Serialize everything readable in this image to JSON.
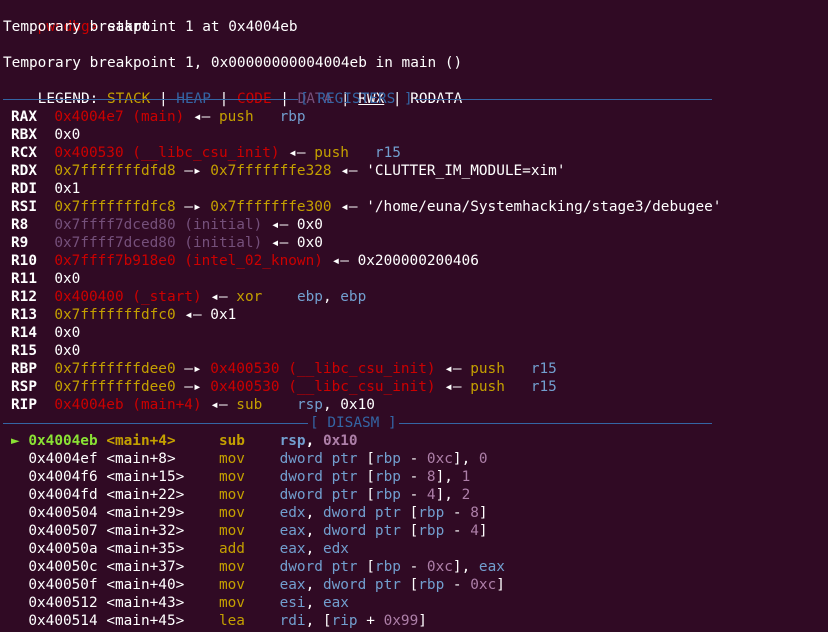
{
  "prompt": "pwndbg>",
  "command": " start",
  "info1": "Temporary breakpoint 1 at 0x4004eb",
  "info2": "Temporary breakpoint 1, 0x00000000004004eb in main ()",
  "legend": {
    "label": "LEGEND: ",
    "stack": "STACK",
    "heap": "HEAP",
    "code": "CODE",
    "data": "DATA",
    "rwx": "RWX",
    "rodata": "RODATA",
    "sep": " | "
  },
  "sections": {
    "registers": "[ REGISTERS ]",
    "disasm": "[ DISASM ]"
  },
  "colors": {
    "background": "#300a24",
    "stack": "#c4a000",
    "heap": "#3465a4",
    "code": "#cc0000",
    "data": "#75507b",
    "separator": "#3465a4",
    "current": "#8ae234"
  },
  "registers": [
    {
      "name": "RAX",
      "parts": [
        [
          "red",
          "0x4004e7 (main)"
        ],
        [
          "wht",
          " ◂— "
        ],
        [
          "yel",
          "push"
        ],
        [
          "wht",
          "   "
        ],
        [
          "ltblu",
          "rbp"
        ]
      ]
    },
    {
      "name": "RBX",
      "parts": [
        [
          "wht",
          "0x0"
        ]
      ]
    },
    {
      "name": "RCX",
      "parts": [
        [
          "red",
          "0x400530 (__libc_csu_init)"
        ],
        [
          "wht",
          " ◂— "
        ],
        [
          "yel",
          "push"
        ],
        [
          "wht",
          "   "
        ],
        [
          "ltblu",
          "r15"
        ]
      ]
    },
    {
      "name": "RDX",
      "parts": [
        [
          "yel",
          "0x7fffffffdfd8"
        ],
        [
          "wht",
          " —▸ "
        ],
        [
          "yel",
          "0x7fffffffe328"
        ],
        [
          "wht",
          " ◂— 'CLUTTER_IM_MODULE=xim'"
        ]
      ]
    },
    {
      "name": "RDI",
      "parts": [
        [
          "wht",
          "0x1"
        ]
      ]
    },
    {
      "name": "RSI",
      "parts": [
        [
          "yel",
          "0x7fffffffdfc8"
        ],
        [
          "wht",
          " —▸ "
        ],
        [
          "yel",
          "0x7fffffffe300"
        ],
        [
          "wht",
          " ◂— '/home/euna/Systemhacking/stage3/debugee'"
        ]
      ]
    },
    {
      "name": "R8",
      "parts": [
        [
          "dim",
          "0x7ffff7dced80 (initial)"
        ],
        [
          "wht",
          " ◂— 0x0"
        ]
      ]
    },
    {
      "name": "R9",
      "parts": [
        [
          "dim",
          "0x7ffff7dced80 (initial)"
        ],
        [
          "wht",
          " ◂— 0x0"
        ]
      ]
    },
    {
      "name": "R10",
      "parts": [
        [
          "red",
          "0x7ffff7b918e0 (intel_02_known)"
        ],
        [
          "wht",
          " ◂— 0x200000200406"
        ]
      ]
    },
    {
      "name": "R11",
      "parts": [
        [
          "wht",
          "0x0"
        ]
      ]
    },
    {
      "name": "R12",
      "parts": [
        [
          "red",
          "0x400400 (_start)"
        ],
        [
          "wht",
          " ◂— "
        ],
        [
          "yel",
          "xor"
        ],
        [
          "wht",
          "    "
        ],
        [
          "ltblu",
          "ebp"
        ],
        [
          "wht",
          ", "
        ],
        [
          "ltblu",
          "ebp"
        ]
      ]
    },
    {
      "name": "R13",
      "parts": [
        [
          "yel",
          "0x7fffffffdfc0"
        ],
        [
          "wht",
          " ◂— 0x1"
        ]
      ]
    },
    {
      "name": "R14",
      "parts": [
        [
          "wht",
          "0x0"
        ]
      ]
    },
    {
      "name": "R15",
      "parts": [
        [
          "wht",
          "0x0"
        ]
      ]
    },
    {
      "name": "RBP",
      "parts": [
        [
          "yel",
          "0x7fffffffdee0"
        ],
        [
          "wht",
          " —▸ "
        ],
        [
          "red",
          "0x400530 (__libc_csu_init)"
        ],
        [
          "wht",
          " ◂— "
        ],
        [
          "yel",
          "push"
        ],
        [
          "wht",
          "   "
        ],
        [
          "ltblu",
          "r15"
        ]
      ]
    },
    {
      "name": "RSP",
      "parts": [
        [
          "yel",
          "0x7fffffffdee0"
        ],
        [
          "wht",
          " —▸ "
        ],
        [
          "red",
          "0x400530 (__libc_csu_init)"
        ],
        [
          "wht",
          " ◂— "
        ],
        [
          "yel",
          "push"
        ],
        [
          "wht",
          "   "
        ],
        [
          "ltblu",
          "r15"
        ]
      ]
    },
    {
      "name": "RIP",
      "parts": [
        [
          "red",
          "0x4004eb (main+4)"
        ],
        [
          "wht",
          " ◂— "
        ],
        [
          "yel",
          "sub"
        ],
        [
          "wht",
          "    "
        ],
        [
          "ltblu",
          "rsp"
        ],
        [
          "wht",
          ", 0x10"
        ]
      ]
    }
  ],
  "disasm": [
    {
      "current": true,
      "addr": "0x4004eb",
      "sym": "<main+4>",
      "op": "sub",
      "args": [
        [
          "ltblu",
          "rsp"
        ],
        [
          "wht",
          ", "
        ],
        [
          "op",
          "0x10"
        ]
      ]
    },
    {
      "addr": "0x4004ef",
      "sym": "<main+8>",
      "op": "mov",
      "args": [
        [
          "ltblu",
          "dword ptr"
        ],
        [
          "wht",
          " ["
        ],
        [
          "ltblu",
          "rbp"
        ],
        [
          "wht",
          " - "
        ],
        [
          "op",
          "0xc"
        ],
        [
          "wht",
          "], "
        ],
        [
          "op",
          "0"
        ]
      ]
    },
    {
      "addr": "0x4004f6",
      "sym": "<main+15>",
      "op": "mov",
      "args": [
        [
          "ltblu",
          "dword ptr"
        ],
        [
          "wht",
          " ["
        ],
        [
          "ltblu",
          "rbp"
        ],
        [
          "wht",
          " - "
        ],
        [
          "op",
          "8"
        ],
        [
          "wht",
          "], "
        ],
        [
          "op",
          "1"
        ]
      ]
    },
    {
      "addr": "0x4004fd",
      "sym": "<main+22>",
      "op": "mov",
      "args": [
        [
          "ltblu",
          "dword ptr"
        ],
        [
          "wht",
          " ["
        ],
        [
          "ltblu",
          "rbp"
        ],
        [
          "wht",
          " - "
        ],
        [
          "op",
          "4"
        ],
        [
          "wht",
          "], "
        ],
        [
          "op",
          "2"
        ]
      ]
    },
    {
      "addr": "0x400504",
      "sym": "<main+29>",
      "op": "mov",
      "args": [
        [
          "ltblu",
          "edx"
        ],
        [
          "wht",
          ", "
        ],
        [
          "ltblu",
          "dword ptr"
        ],
        [
          "wht",
          " ["
        ],
        [
          "ltblu",
          "rbp"
        ],
        [
          "wht",
          " - "
        ],
        [
          "op",
          "8"
        ],
        [
          "wht",
          "]"
        ]
      ]
    },
    {
      "addr": "0x400507",
      "sym": "<main+32>",
      "op": "mov",
      "args": [
        [
          "ltblu",
          "eax"
        ],
        [
          "wht",
          ", "
        ],
        [
          "ltblu",
          "dword ptr"
        ],
        [
          "wht",
          " ["
        ],
        [
          "ltblu",
          "rbp"
        ],
        [
          "wht",
          " - "
        ],
        [
          "op",
          "4"
        ],
        [
          "wht",
          "]"
        ]
      ]
    },
    {
      "addr": "0x40050a",
      "sym": "<main+35>",
      "op": "add",
      "args": [
        [
          "ltblu",
          "eax"
        ],
        [
          "wht",
          ", "
        ],
        [
          "ltblu",
          "edx"
        ]
      ]
    },
    {
      "addr": "0x40050c",
      "sym": "<main+37>",
      "op": "mov",
      "args": [
        [
          "ltblu",
          "dword ptr"
        ],
        [
          "wht",
          " ["
        ],
        [
          "ltblu",
          "rbp"
        ],
        [
          "wht",
          " - "
        ],
        [
          "op",
          "0xc"
        ],
        [
          "wht",
          "], "
        ],
        [
          "ltblu",
          "eax"
        ]
      ]
    },
    {
      "addr": "0x40050f",
      "sym": "<main+40>",
      "op": "mov",
      "args": [
        [
          "ltblu",
          "eax"
        ],
        [
          "wht",
          ", "
        ],
        [
          "ltblu",
          "dword ptr"
        ],
        [
          "wht",
          " ["
        ],
        [
          "ltblu",
          "rbp"
        ],
        [
          "wht",
          " - "
        ],
        [
          "op",
          "0xc"
        ],
        [
          "wht",
          "]"
        ]
      ]
    },
    {
      "addr": "0x400512",
      "sym": "<main+43>",
      "op": "mov",
      "args": [
        [
          "ltblu",
          "esi"
        ],
        [
          "wht",
          ", "
        ],
        [
          "ltblu",
          "eax"
        ]
      ]
    },
    {
      "addr": "0x400514",
      "sym": "<main+45>",
      "op": "lea",
      "args": [
        [
          "ltblu",
          "rdi"
        ],
        [
          "wht",
          ", ["
        ],
        [
          "ltblu",
          "rip"
        ],
        [
          "wht",
          " + "
        ],
        [
          "op",
          "0x99"
        ],
        [
          "wht",
          "]"
        ]
      ]
    }
  ]
}
